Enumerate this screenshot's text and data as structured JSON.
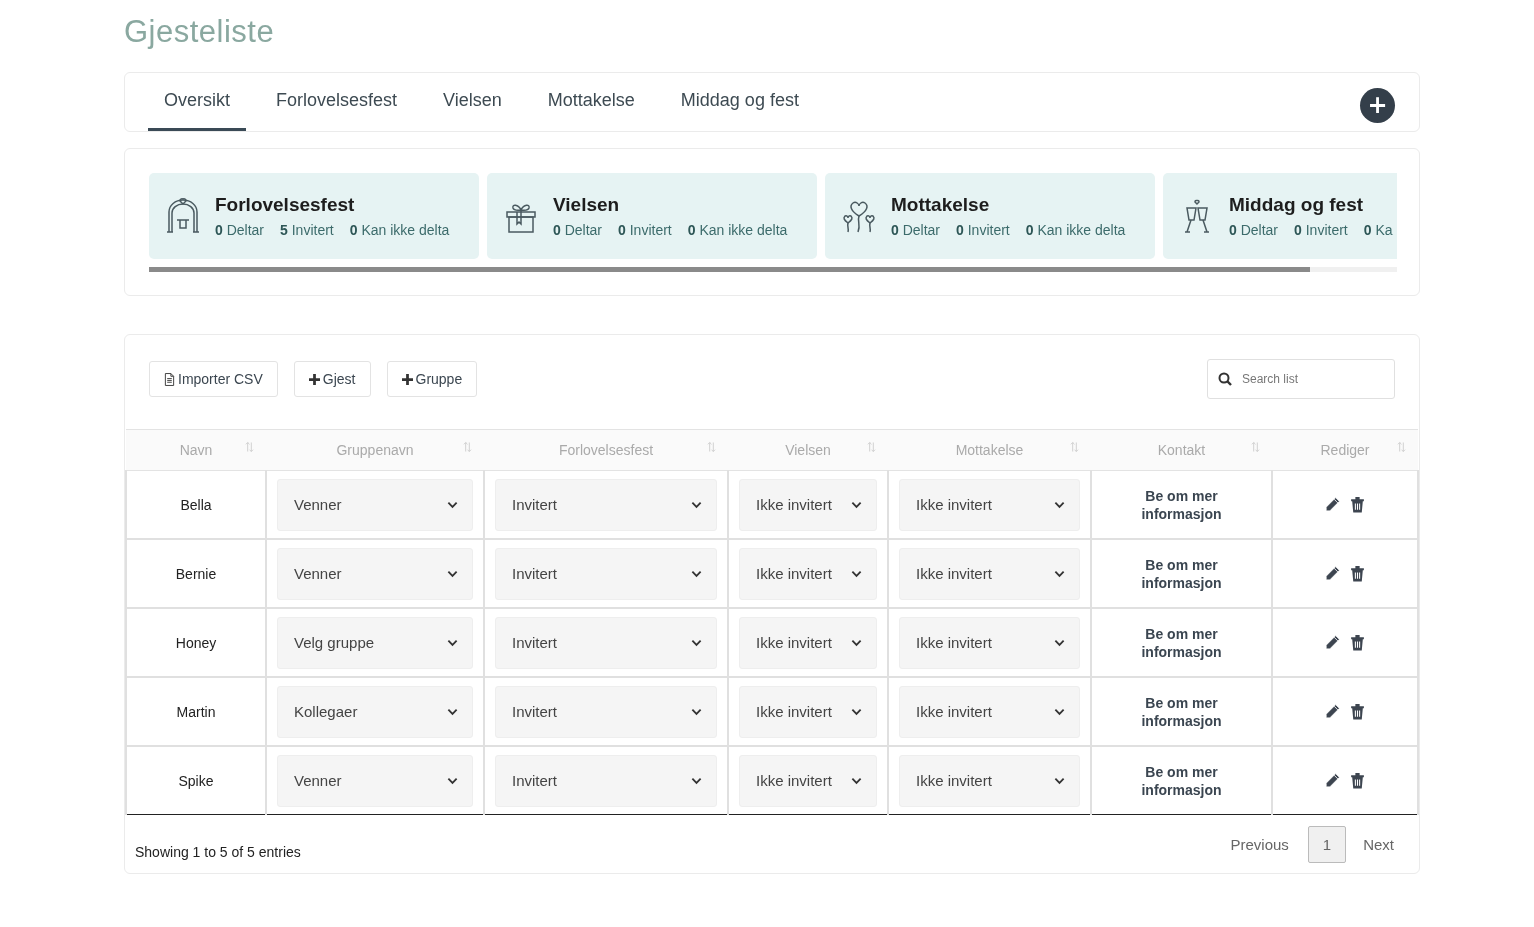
{
  "page_title": "Gjesteliste",
  "tabs": [
    {
      "label": "Oversikt",
      "selected": true
    },
    {
      "label": "Forlovelsesfest",
      "selected": false
    },
    {
      "label": "Vielsen",
      "selected": false
    },
    {
      "label": "Mottakelse",
      "selected": false
    },
    {
      "label": "Middag og fest",
      "selected": false
    }
  ],
  "add_tab_button": "+",
  "events": [
    {
      "kind": "arch",
      "title": "Forlovelsesfest",
      "stats": [
        {
          "count": "0",
          "label": "Deltar"
        },
        {
          "count": "5",
          "label": "Invitert"
        },
        {
          "count": "0",
          "label": "Kan ikke delta"
        }
      ]
    },
    {
      "kind": "gift",
      "title": "Vielsen",
      "stats": [
        {
          "count": "0",
          "label": "Deltar"
        },
        {
          "count": "0",
          "label": "Invitert"
        },
        {
          "count": "0",
          "label": "Kan ikke delta"
        }
      ]
    },
    {
      "kind": "balloons",
      "title": "Mottakelse",
      "stats": [
        {
          "count": "0",
          "label": "Deltar"
        },
        {
          "count": "0",
          "label": "Invitert"
        },
        {
          "count": "0",
          "label": "Kan ikke delta"
        }
      ]
    },
    {
      "kind": "glasses",
      "title": "Middag og fest",
      "stats": [
        {
          "count": "0",
          "label": "Deltar"
        },
        {
          "count": "0",
          "label": "Invitert"
        },
        {
          "count": "0",
          "label": "Ka"
        }
      ]
    }
  ],
  "toolbar": {
    "buttons": [
      {
        "kind": "file",
        "label": "Importer CSV"
      },
      {
        "kind": "plus",
        "label": "Gjest"
      },
      {
        "kind": "plus",
        "label": "Gruppe"
      }
    ],
    "search": {
      "placeholder": "Search list"
    }
  },
  "table": {
    "columns": [
      "Navn",
      "Gruppenavn",
      "Forlovelsesfest",
      "Vielsen",
      "Mottakelse",
      "Kontakt",
      "Rediger"
    ],
    "rows": [
      {
        "name": "Bella",
        "group": "Venner",
        "engagement": "Invitert",
        "wedding": "Ikke invitert",
        "reception": "Ikke invitert",
        "contact": "Be om mer informasjon"
      },
      {
        "name": "Bernie",
        "group": "Venner",
        "engagement": "Invitert",
        "wedding": "Ikke invitert",
        "reception": "Ikke invitert",
        "contact": "Be om mer informasjon"
      },
      {
        "name": "Honey",
        "group": "Velg gruppe",
        "engagement": "Invitert",
        "wedding": "Ikke invitert",
        "reception": "Ikke invitert",
        "contact": "Be om mer informasjon"
      },
      {
        "name": "Martin",
        "group": "Kollegaer",
        "engagement": "Invitert",
        "wedding": "Ikke invitert",
        "reception": "Ikke invitert",
        "contact": "Be om mer informasjon"
      },
      {
        "name": "Spike",
        "group": "Venner",
        "engagement": "Invitert",
        "wedding": "Ikke invitert",
        "reception": "Ikke invitert",
        "contact": "Be om mer informasjon"
      }
    ]
  },
  "footer": {
    "info": "Showing 1 to 5 of 5 entries",
    "pagination": [
      {
        "kind": "prev",
        "label": "Previous",
        "selected": false
      },
      {
        "kind": "page",
        "label": "1",
        "selected": true
      },
      {
        "kind": "next",
        "label": "Next",
        "selected": false
      }
    ]
  }
}
